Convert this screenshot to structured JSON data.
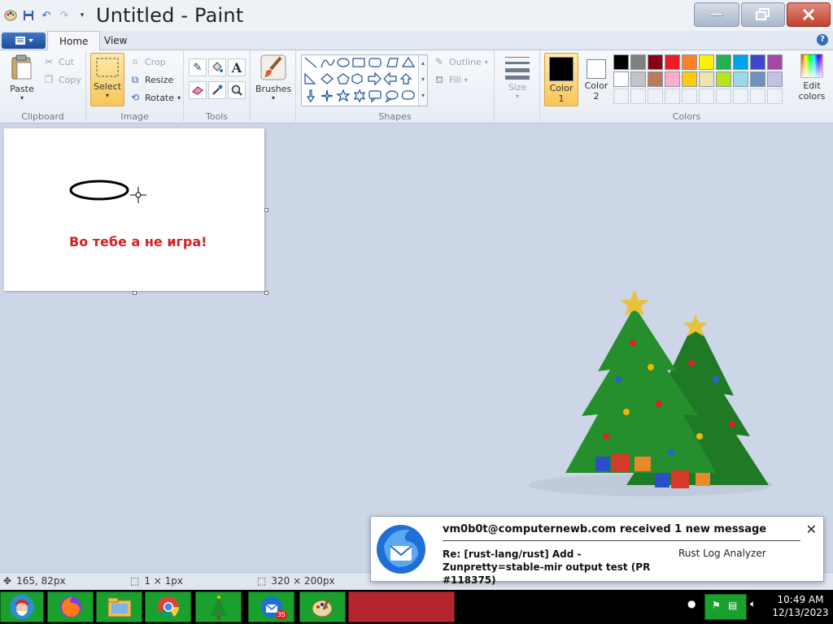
{
  "window": {
    "title": "Untitled - Paint"
  },
  "tabs": [
    {
      "label": "Home",
      "active": true
    },
    {
      "label": "View",
      "active": false
    }
  ],
  "ribbon": {
    "clipboard": {
      "group_label": "Clipboard",
      "paste_label": "Paste",
      "cut_label": "Cut",
      "copy_label": "Copy"
    },
    "image": {
      "group_label": "Image",
      "select_label": "Select",
      "crop_label": "Crop",
      "resize_label": "Resize",
      "rotate_label": "Rotate"
    },
    "tools": {
      "group_label": "Tools",
      "items": [
        "pencil-icon",
        "fill-icon",
        "text-icon",
        "eraser-icon",
        "color-picker-icon",
        "magnifier-icon"
      ]
    },
    "brushes": {
      "label": "Brushes"
    },
    "shapes": {
      "group_label": "Shapes",
      "outline_label": "Outline",
      "fill_label": "Fill"
    },
    "size": {
      "label": "Size"
    },
    "colors": {
      "group_label": "Colors",
      "color1_label": "Color",
      "color1_num": "1",
      "color2_label": "Color",
      "color2_num": "2",
      "color1_value": "#000000",
      "color2_value": "#ffffff",
      "edit_label": "Edit colors",
      "palette_row1": [
        "#000000",
        "#7f7f7f",
        "#880015",
        "#ed1c24",
        "#ff7f27",
        "#fff200",
        "#22b14c",
        "#00a2e8",
        "#3f48cc",
        "#a349a4"
      ],
      "palette_row2": [
        "#ffffff",
        "#c3c3c3",
        "#b97a57",
        "#ffaec9",
        "#ffc90e",
        "#efe4b0",
        "#b5e61d",
        "#99d9ea",
        "#7092be",
        "#c8bfe7"
      ]
    }
  },
  "canvas": {
    "text": "Во тебе а не игра!"
  },
  "status": {
    "cursor_pos": "165, 82px",
    "selection_size": "1 × 1px",
    "canvas_size": "320 × 200px"
  },
  "notification": {
    "title": "vm0b0t@computernewb.com received 1 new message",
    "subject": "Re: [rust-lang/rust] Add -Zunpretty=stable-mir output test (PR #118375)",
    "folder": "Rust Log Analyzer"
  },
  "taskbar": {
    "clock_time": "10:49 AM",
    "clock_date": "12/13/2023",
    "thunderbird_badge": "35"
  }
}
